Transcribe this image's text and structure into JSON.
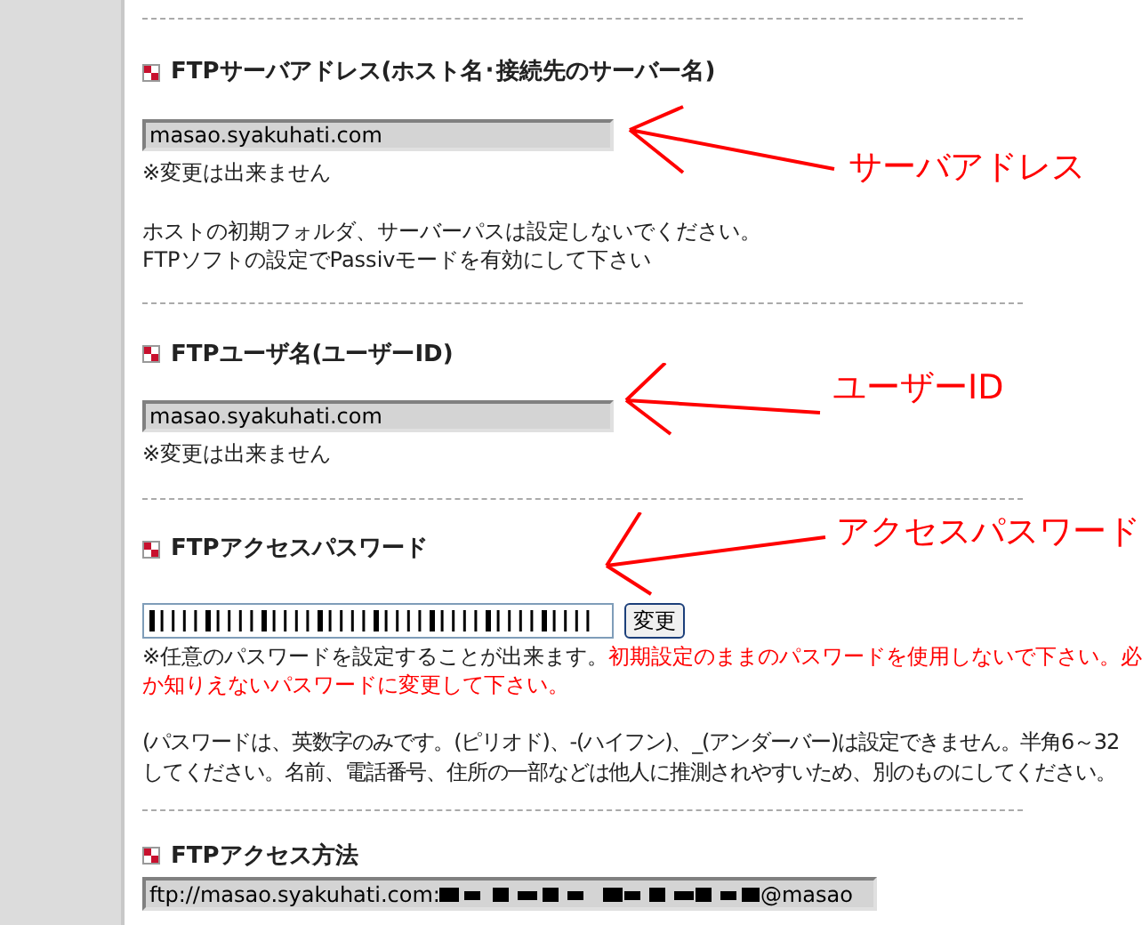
{
  "sections": [
    {
      "kind": "readonly_field",
      "heading": "FTPサーバアドレス(ホスト名･接続先のサーバー名)",
      "value": "masao.syakuhati.com",
      "note": "※変更は出来ません",
      "lines": [
        "ホストの初期フォルダ、サーバーパスは設定しないでください。",
        "FTPソフトの設定でPassivモードを有効にして下さい"
      ],
      "annotation": "サーバアドレス"
    },
    {
      "kind": "readonly_field",
      "heading": "FTPユーザ名(ユーザーID)",
      "value": "masao.syakuhati.com",
      "note": "※変更は出来ません",
      "annotation": "ユーザーID"
    },
    {
      "kind": "password_field",
      "heading": "FTPアクセスパスワード",
      "button": "変更",
      "note": "※任意のパスワードを設定することが出来ます。",
      "warning": "初期設定のままのパスワードを使用しないで下さい。必",
      "warning_cont": "か知りえないパスワードに変更して下さい。",
      "lines": [
        "(パスワードは、英数字のみです。(ピリオド)、-(ハイフン)、_(アンダーバー)は設定できません。半角6～32",
        "してください。名前、電話番号、住所の一部などは他人に推測されやすいため、別のものにしてください。"
      ],
      "annotation": "アクセスパスワード"
    },
    {
      "kind": "access_url",
      "heading": "FTPアクセス方法",
      "url_prefix": "ftp://masao.syakuhati.com:",
      "url_suffix": "@masao"
    }
  ]
}
